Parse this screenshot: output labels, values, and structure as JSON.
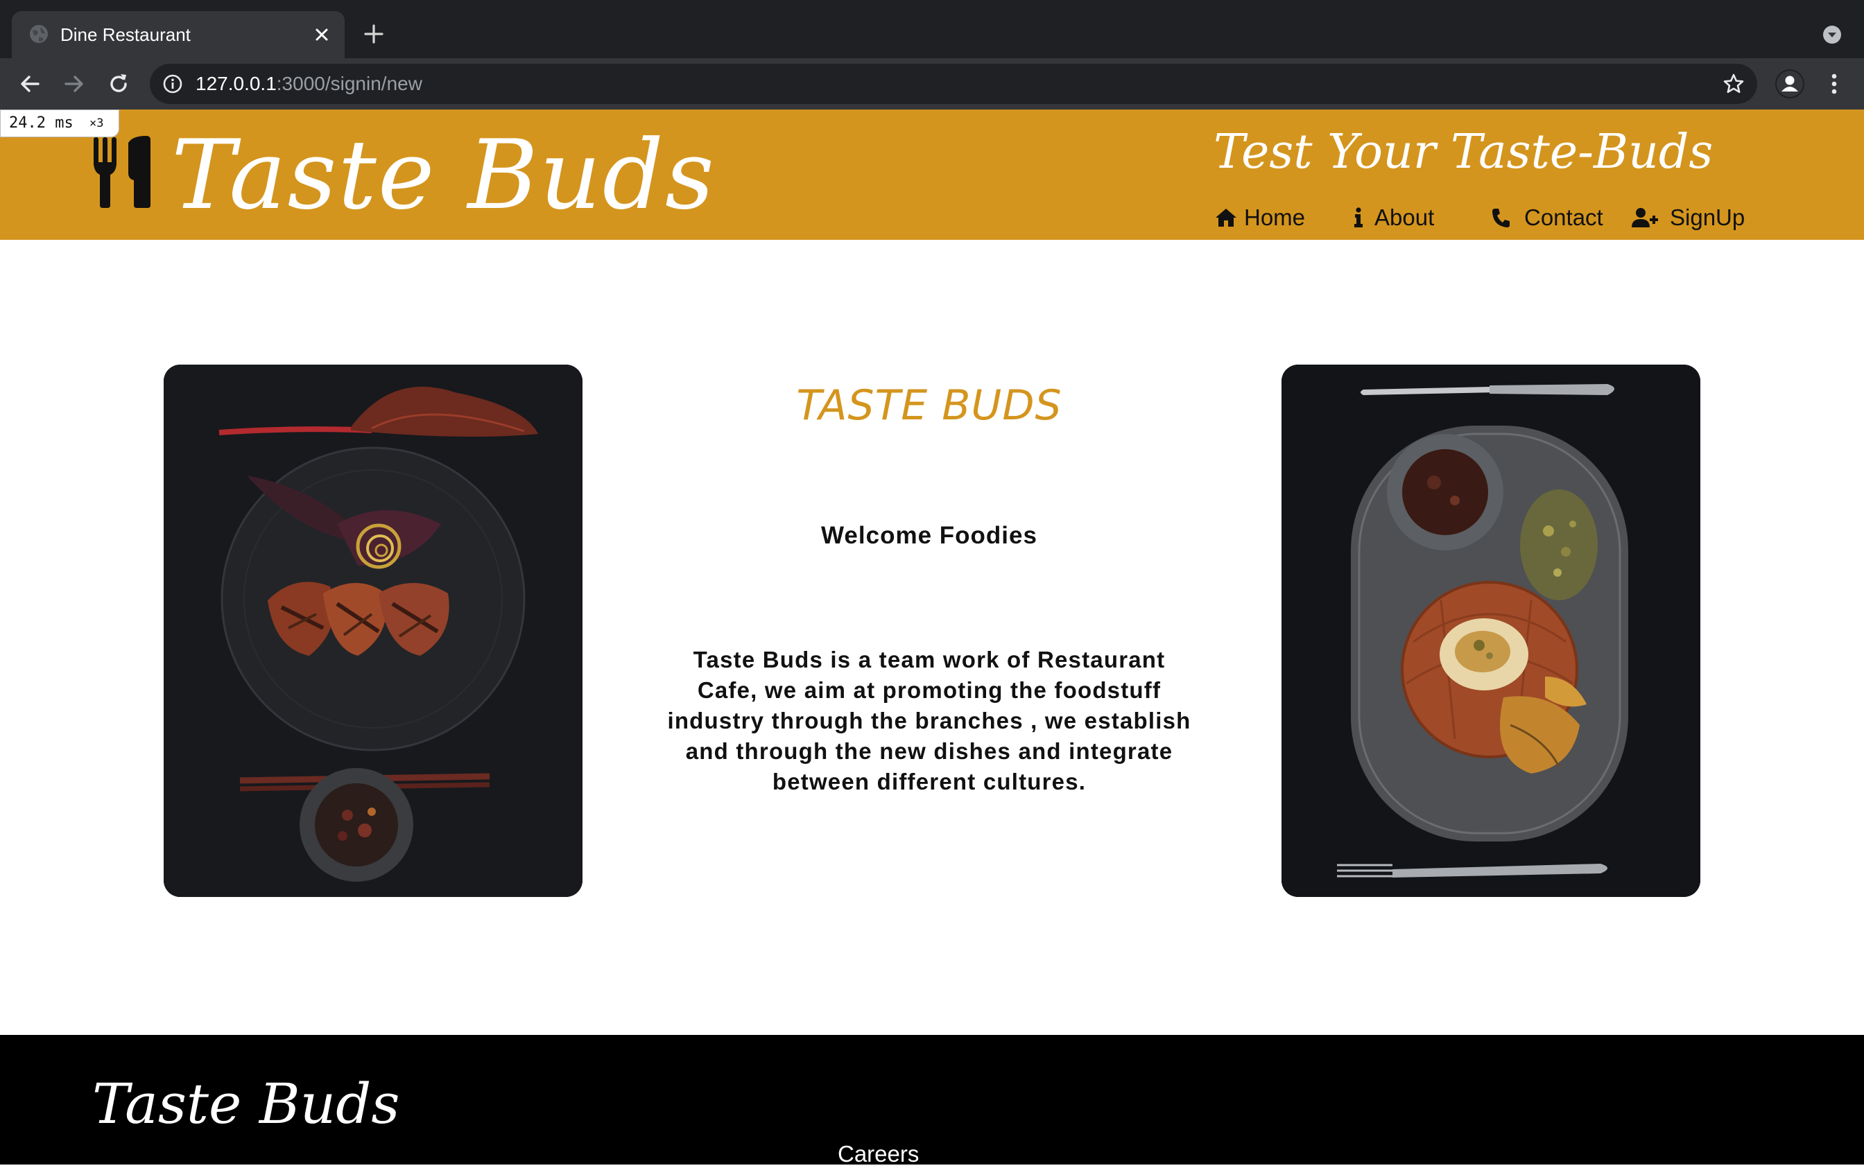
{
  "browser": {
    "tab_title": "Dine Restaurant",
    "url_host": "127.0.0.1",
    "url_rest": ":3000/signin/new",
    "perf_ms": "24.2 ms",
    "perf_mult": "×3"
  },
  "header": {
    "brand": "Taste Buds",
    "tagline": "Test Your Taste-Buds",
    "background": "#d4951e"
  },
  "nav": {
    "items": [
      {
        "label": "Home",
        "icon": "home-icon"
      },
      {
        "label": "About",
        "icon": "info-icon"
      },
      {
        "label": "Contact",
        "icon": "phone-icon"
      },
      {
        "label": "SignUp",
        "icon": "user-plus-icon"
      }
    ]
  },
  "main": {
    "title": "TASTE BUDS",
    "welcome": "Welcome Foodies",
    "about": "Taste Buds is a team work of Restaurant Cafe, we aim at promoting the foodstuff industry through the branches , we establish and through the new dishes and integrate between different cultures.",
    "accent_color": "#d4951e"
  },
  "footer": {
    "brand": "Taste Buds",
    "link": "Careers"
  }
}
